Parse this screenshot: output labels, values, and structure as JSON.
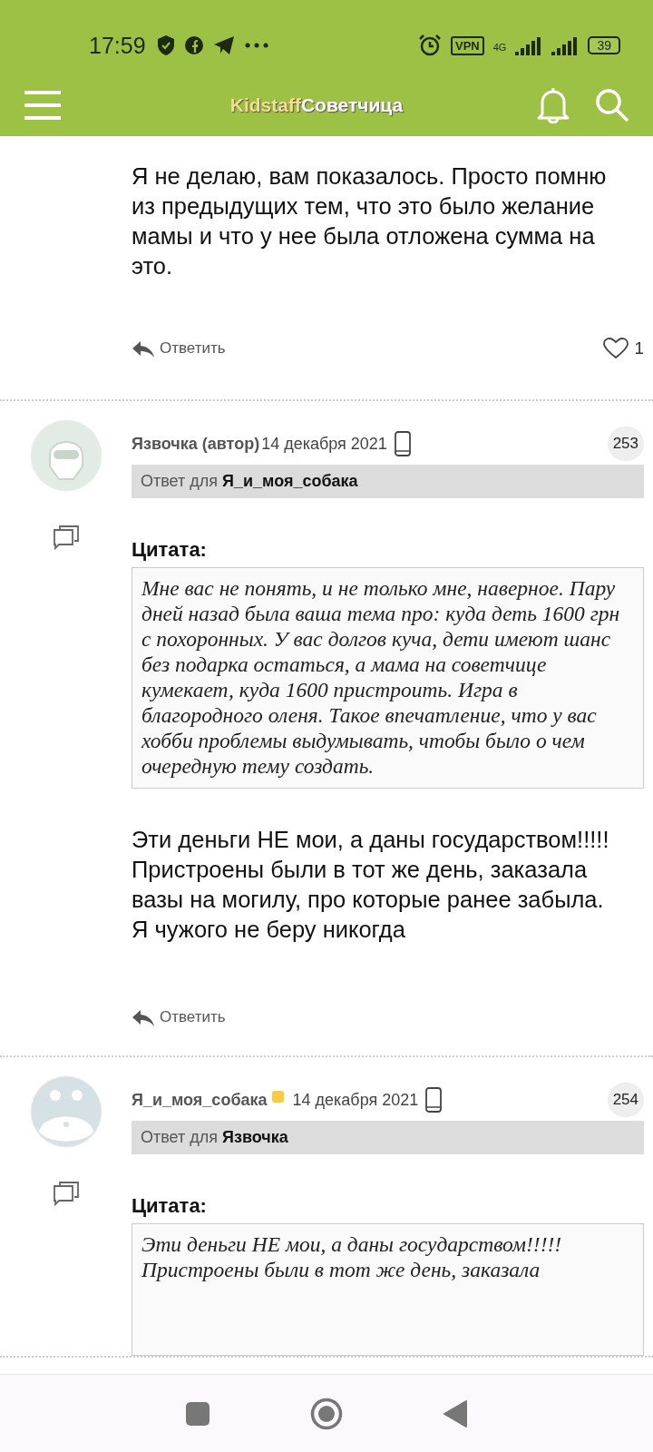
{
  "status_bar": {
    "time": "17:59",
    "vpn": "VPN",
    "network": "4G",
    "battery": "39"
  },
  "app_bar": {
    "brand": "Kidstaff",
    "section": "Советчица"
  },
  "posts": [
    {
      "kind": "partial",
      "body": [
        "Я не делаю, вам показалось. Просто помню из предыдущих тем, что это было желание мамы и что у нее была отложена сумма на это."
      ],
      "reply": "Ответить",
      "likes": "1"
    },
    {
      "kind": "full",
      "author": "Язвочка (автор)",
      "status_badge": false,
      "date": "14 декабря 2021",
      "number": "253",
      "reply_to_prefix": "Ответ для",
      "reply_to_name": "Я_и_моя_собака",
      "quote_label": "Цитата:",
      "quote": "Мне вас не понять, и не только мне, наверное. Пару дней назад была ваша тема про: куда деть 1600 грн с похоронных. У вас долгов куча, дети имеют шанс без подарка остаться, а мама на советчице кумекает, куда 1600 пристроить. Игра в благородного оленя. Такое впечатление, что у вас хобби проблемы выдумывать, чтобы было о чем очередную тему создать.",
      "body": [
        "Эти деньги НЕ мои, а даны государством!!!!!",
        "Пристроены были в тот же день, заказала вазы на могилу, про которые ранее забыла.",
        "Я чужого не беру никогда"
      ],
      "reply": "Ответить"
    },
    {
      "kind": "full",
      "author": "Я_и_моя_собака",
      "status_badge": true,
      "date": "14 декабря 2021",
      "number": "254",
      "reply_to_prefix": "Ответ для",
      "reply_to_name": "Язвочка",
      "quote_label": "Цитата:",
      "quote": "Эти деньги НЕ мои, а даны государством!!!!! Пристроены были в тот же день, заказала"
    }
  ]
}
